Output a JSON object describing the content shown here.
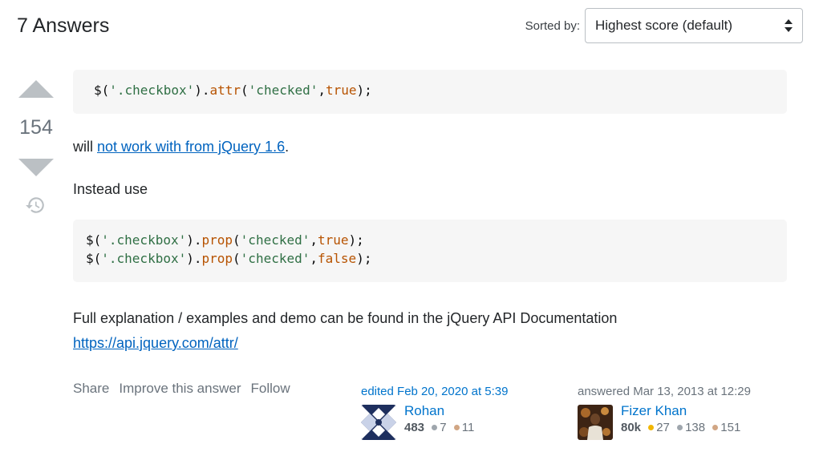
{
  "header": {
    "answers_count": "7 Answers",
    "sort_label": "Sorted by:",
    "sort_value": "Highest score (default)"
  },
  "vote": {
    "count": "154"
  },
  "post": {
    "code1": [
      {
        "t": "$(",
        "c": "punc"
      },
      {
        "t": "'.checkbox'",
        "c": "str"
      },
      {
        "t": ").",
        "c": "punc"
      },
      {
        "t": "attr",
        "c": "fn"
      },
      {
        "t": "(",
        "c": "punc"
      },
      {
        "t": "'checked'",
        "c": "str"
      },
      {
        "t": ",",
        "c": "punc"
      },
      {
        "t": "true",
        "c": "kw"
      },
      {
        "t": ");",
        "c": "punc"
      }
    ],
    "para1_prefix": "will ",
    "para1_link": "not work with from jQuery 1.6",
    "para1_suffix": ".",
    "para2": "Instead use",
    "code2": [
      [
        {
          "t": "$(",
          "c": "punc"
        },
        {
          "t": "'.checkbox'",
          "c": "str"
        },
        {
          "t": ").",
          "c": "punc"
        },
        {
          "t": "prop",
          "c": "fn"
        },
        {
          "t": "(",
          "c": "punc"
        },
        {
          "t": "'checked'",
          "c": "str"
        },
        {
          "t": ",",
          "c": "punc"
        },
        {
          "t": "true",
          "c": "kw"
        },
        {
          "t": ");",
          "c": "punc"
        }
      ],
      [
        {
          "t": "$(",
          "c": "punc"
        },
        {
          "t": "'.checkbox'",
          "c": "str"
        },
        {
          "t": ").",
          "c": "punc"
        },
        {
          "t": "prop",
          "c": "fn"
        },
        {
          "t": "(",
          "c": "punc"
        },
        {
          "t": "'checked'",
          "c": "str"
        },
        {
          "t": ",",
          "c": "punc"
        },
        {
          "t": "false",
          "c": "kw"
        },
        {
          "t": ");",
          "c": "punc"
        }
      ]
    ],
    "para3": "Full explanation / examples and demo can be found in the jQuery API Documentation",
    "para3_link": "https://api.jquery.com/attr/"
  },
  "menu": {
    "share": "Share",
    "improve": "Improve this answer",
    "follow": "Follow"
  },
  "editor": {
    "action": "edited Feb 20, 2020 at 5:39",
    "name": "Rohan",
    "rep": "483",
    "silver": "7",
    "bronze": "11"
  },
  "answerer": {
    "action": "answered Mar 13, 2013 at 12:29",
    "name": "Fizer Khan",
    "rep": "80k",
    "gold": "27",
    "silver": "138",
    "bronze": "151"
  },
  "colors": {
    "link": "#0063bf",
    "gold": "#f1b600",
    "silver": "#9fa6ad",
    "bronze": "#d1a684"
  },
  "icons": [
    "vote-up-icon",
    "vote-down-icon",
    "history-icon",
    "sort-arrows-icon"
  ]
}
